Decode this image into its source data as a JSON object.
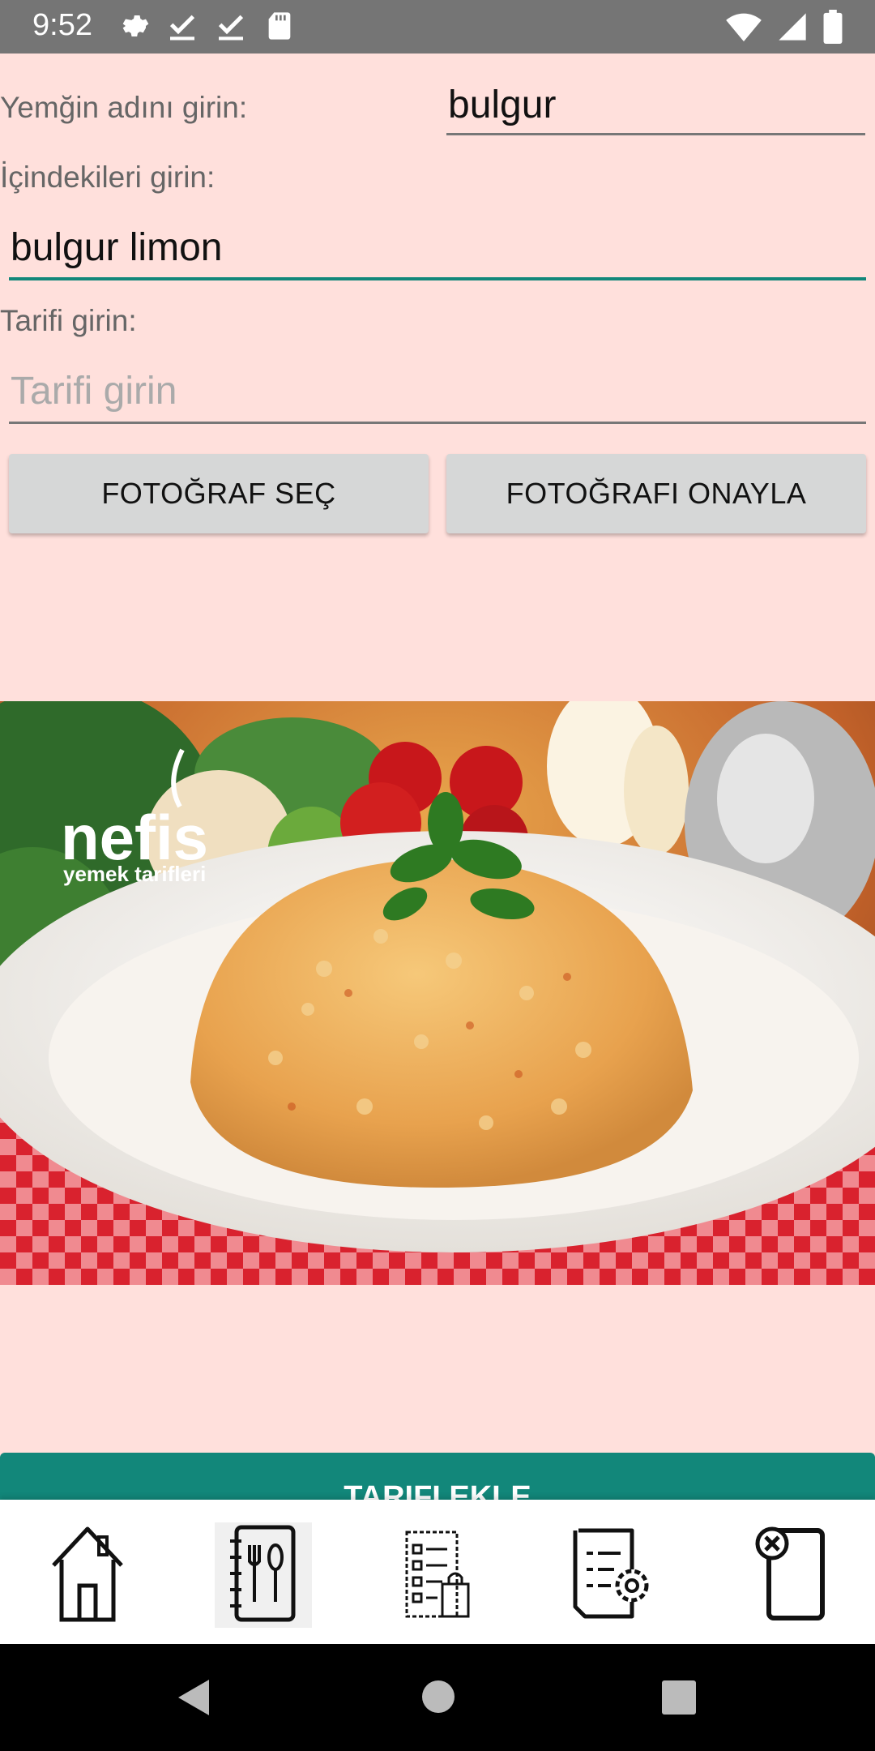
{
  "status_bar": {
    "time": "9:52",
    "left_icons": [
      "settings-icon",
      "check-download-icon",
      "check-download-icon",
      "sd-card-icon"
    ],
    "right_icons": [
      "wifi-icon",
      "signal-icon",
      "battery-icon"
    ]
  },
  "form": {
    "name_label": "Yemğin adını girin:",
    "name_value": "bulgur",
    "ingredients_label": "İçindekileri  girin:",
    "ingredients_value": "bulgur limon",
    "recipe_label": "Tarifi  girin:",
    "recipe_placeholder": "Tarifi girin",
    "recipe_value": ""
  },
  "buttons": {
    "choose_photo": "FOTOĞRAF SEÇ",
    "confirm_photo": "FOTOĞRAFI ONAYLA",
    "add_recipe": "TARIFI EKLE"
  },
  "photo": {
    "watermark_brand": "nefis",
    "watermark_sub": "yemek tarifleri"
  },
  "bottom_nav": {
    "items": [
      "home-icon",
      "recipe-book-icon",
      "shopping-list-icon",
      "document-settings-icon",
      "delete-document-icon"
    ]
  },
  "colors": {
    "background": "#FFE0DC",
    "accent": "#12877A",
    "button_gray": "#D6D7D7",
    "status_bar": "#757575"
  }
}
